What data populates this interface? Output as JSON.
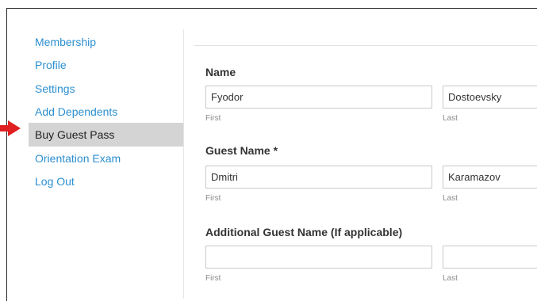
{
  "sidebar": {
    "items": [
      {
        "label": "Membership"
      },
      {
        "label": "Profile"
      },
      {
        "label": "Settings"
      },
      {
        "label": "Add Dependents"
      },
      {
        "label": "Buy Guest Pass"
      },
      {
        "label": "Orientation Exam"
      },
      {
        "label": "Log Out"
      }
    ],
    "active_index": 4
  },
  "form": {
    "name": {
      "label": "Name",
      "first": {
        "value": "Fyodor",
        "sublabel": "First"
      },
      "last": {
        "value": "Dostoevsky",
        "sublabel": "Last"
      }
    },
    "guest_name": {
      "label": "Guest Name",
      "required_mark": "*",
      "first": {
        "value": "Dmitri",
        "sublabel": "First"
      },
      "last": {
        "value": "Karamazov",
        "sublabel": "Last"
      }
    },
    "additional_guest": {
      "label": "Additional Guest Name (If applicable)",
      "first": {
        "value": "",
        "sublabel": "First"
      },
      "last": {
        "value": "",
        "sublabel": "Last"
      }
    }
  },
  "colors": {
    "link": "#2c8fd0",
    "active_bg": "#d4d4d4",
    "arrow": "#e02020"
  }
}
